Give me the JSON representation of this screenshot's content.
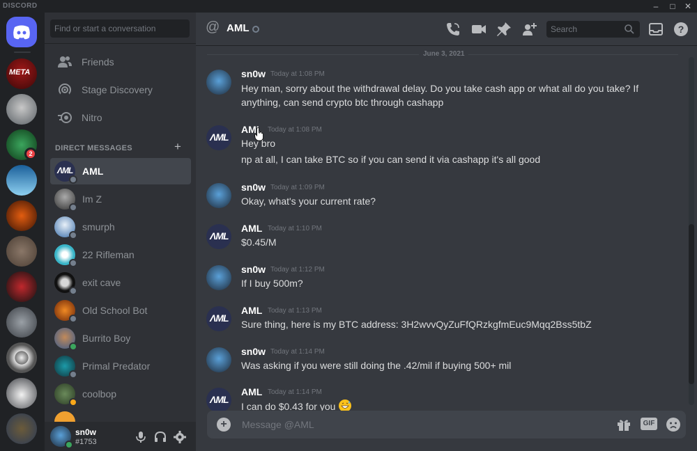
{
  "app": {
    "brand": "DISCORD",
    "window_controls": [
      "minimize",
      "maximize",
      "close"
    ]
  },
  "colors": {
    "blurple": "#5865f2",
    "online": "#3ba55d",
    "idle": "#faa81a",
    "offline": "#747f8d",
    "mention_badge": "#ed4245"
  },
  "servers": [
    {
      "name": "home",
      "icon": "discord-logo-icon"
    },
    {
      "name": "meta",
      "icon": "meta-server-icon"
    },
    {
      "name": "server-2",
      "icon": "server-icon"
    },
    {
      "name": "server-3",
      "icon": "server-icon",
      "badge": "2"
    },
    {
      "name": "server-4",
      "icon": "server-icon"
    },
    {
      "name": "server-5",
      "icon": "server-icon"
    },
    {
      "name": "server-6",
      "icon": "server-icon"
    },
    {
      "name": "server-7",
      "icon": "server-icon"
    },
    {
      "name": "server-8",
      "icon": "server-icon"
    },
    {
      "name": "server-9",
      "icon": "server-icon"
    },
    {
      "name": "server-10",
      "icon": "server-icon"
    },
    {
      "name": "server-11",
      "icon": "server-icon"
    }
  ],
  "meta_server_label": "META",
  "server_badge": "2",
  "sidebar": {
    "search_placeholder": "Find or start a conversation",
    "nav": [
      {
        "label": "Friends",
        "icon": "friends-icon"
      },
      {
        "label": "Stage Discovery",
        "icon": "stage-icon"
      },
      {
        "label": "Nitro",
        "icon": "nitro-icon"
      }
    ],
    "dm_header": "DIRECT MESSAGES",
    "dm_add": "+",
    "dms": [
      {
        "name": "AML",
        "status": "offline",
        "active": true
      },
      {
        "name": "Im Z",
        "status": "offline"
      },
      {
        "name": "smurph",
        "status": "offline"
      },
      {
        "name": "22 Rifleman",
        "status": "offline"
      },
      {
        "name": "exit cave",
        "status": "offline"
      },
      {
        "name": "Old School Bot",
        "status": "offline"
      },
      {
        "name": "Burrito Boy",
        "status": "online"
      },
      {
        "name": "Primal Predator",
        "status": "offline"
      },
      {
        "name": "coolbop",
        "status": "idle"
      }
    ]
  },
  "user": {
    "name": "sn0w",
    "tag": "#1753",
    "status": "online",
    "controls": [
      "microphone-icon",
      "headphones-icon",
      "settings-icon"
    ]
  },
  "chat": {
    "recipient": "AML",
    "header_search_placeholder": "Search",
    "header_icons": [
      "call-icon",
      "video-icon",
      "pin-icon",
      "add-friend-icon",
      "inbox-icon",
      "help-icon"
    ],
    "date_divider": "June 3, 2021",
    "messages": [
      {
        "author": "sn0w",
        "timestamp": "Today at 1:08 PM",
        "lines": [
          "Hey man, sorry about the withdrawal delay. Do you take cash app or what all do you take? If",
          "anything, can send crypto btc through cashapp"
        ]
      },
      {
        "author": "AML",
        "timestamp": "Today at 1:08 PM",
        "lines": [
          "Hey bro",
          "np at all, I can take BTC so if you can send it via cashapp it's all good"
        ]
      },
      {
        "author": "sn0w",
        "timestamp": "Today at 1:09 PM",
        "lines": [
          "Okay, what's your current rate?"
        ]
      },
      {
        "author": "AML",
        "timestamp": "Today at 1:10 PM",
        "lines": [
          "$0.45/M"
        ]
      },
      {
        "author": "sn0w",
        "timestamp": "Today at 1:12 PM",
        "lines": [
          "If I buy 500m?"
        ]
      },
      {
        "author": "AML",
        "timestamp": "Today at 1:13 PM",
        "lines": [
          "Sure thing, here is my BTC address: 3H2wvvQyZuFfQRzkgfmEuc9Mqq2Bss5tbZ"
        ]
      },
      {
        "author": "sn0w",
        "timestamp": "Today at 1:14 PM",
        "lines": [
          "Was asking if you were still doing the .42/mil if buying 500+ mil"
        ]
      },
      {
        "author": "AML",
        "timestamp": "Today at 1:14 PM",
        "lines": [
          "I can do $0.43 for you"
        ],
        "emoji": "grinning-sweat-emoji"
      }
    ],
    "composer_placeholder": "Message @AML",
    "composer_icons": [
      "gift-icon",
      "gif-icon",
      "emoji-icon"
    ],
    "gif_label": "GIF"
  }
}
